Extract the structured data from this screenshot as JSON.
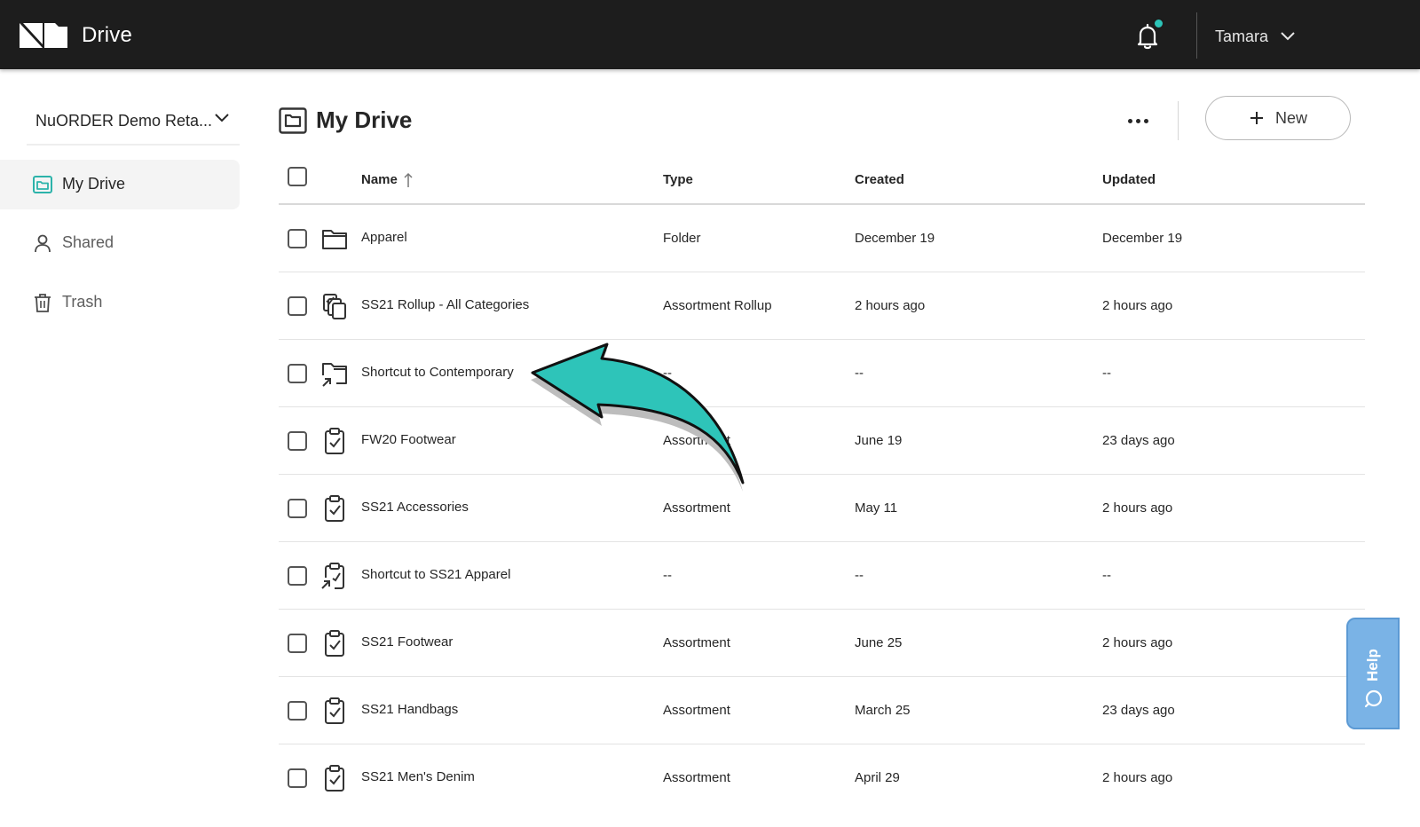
{
  "header": {
    "app_title": "Drive",
    "user_name": "Tamara",
    "has_notification": true
  },
  "sidebar": {
    "org_name": "NuORDER Demo Reta...",
    "items": [
      {
        "label": "My Drive",
        "icon": "folder-icon",
        "active": true
      },
      {
        "label": "Shared",
        "icon": "person-icon",
        "active": false
      },
      {
        "label": "Trash",
        "icon": "trash-icon",
        "active": false
      }
    ]
  },
  "main": {
    "title": "My Drive",
    "new_button_label": "New",
    "columns": {
      "name": "Name",
      "type": "Type",
      "created": "Created",
      "updated": "Updated"
    },
    "rows": [
      {
        "icon": "folder-icon",
        "name": "Apparel",
        "type": "Folder",
        "created": "December 19",
        "updated": "December 19"
      },
      {
        "icon": "rollup-icon",
        "name": "SS21 Rollup - All Categories",
        "type": "Assortment Rollup",
        "created": "2 hours ago",
        "updated": "2 hours ago"
      },
      {
        "icon": "folder-shortcut-icon",
        "name": "Shortcut to Contemporary",
        "type": "--",
        "created": "--",
        "updated": "--"
      },
      {
        "icon": "clipboard-check-icon",
        "name": "FW20 Footwear",
        "type": "Assortment",
        "created": "June 19",
        "updated": "23 days ago"
      },
      {
        "icon": "clipboard-check-icon",
        "name": "SS21 Accessories",
        "type": "Assortment",
        "created": "May 11",
        "updated": "2 hours ago"
      },
      {
        "icon": "clipboard-shortcut-icon",
        "name": "Shortcut to SS21 Apparel",
        "type": "--",
        "created": "--",
        "updated": "--"
      },
      {
        "icon": "clipboard-check-icon",
        "name": "SS21 Footwear",
        "type": "Assortment",
        "created": "June 25",
        "updated": "2 hours ago"
      },
      {
        "icon": "clipboard-check-icon",
        "name": "SS21 Handbags",
        "type": "Assortment",
        "created": "March 25",
        "updated": "23 days ago"
      },
      {
        "icon": "clipboard-check-icon",
        "name": "SS21 Men's Denim",
        "type": "Assortment",
        "created": "April 29",
        "updated": "2 hours ago"
      }
    ]
  },
  "help": {
    "label": "Help"
  },
  "colors": {
    "topbar": "#1d1d1d",
    "accent_teal": "#2cc4b8",
    "help_blue": "#7ab3e6"
  }
}
